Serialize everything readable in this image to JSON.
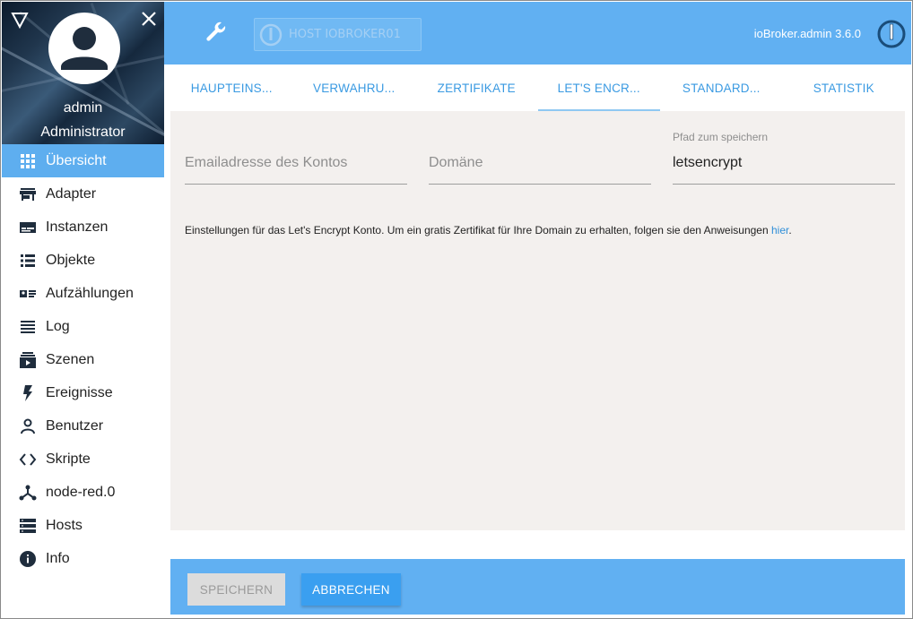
{
  "sidebar": {
    "user": {
      "name": "admin",
      "role": "Administrator"
    },
    "items": [
      {
        "label": "Übersicht",
        "icon": "apps-grid-icon",
        "active": true
      },
      {
        "label": "Adapter",
        "icon": "store-icon"
      },
      {
        "label": "Instanzen",
        "icon": "instances-icon"
      },
      {
        "label": "Objekte",
        "icon": "list-icon"
      },
      {
        "label": "Aufzählungen",
        "icon": "enum-icon"
      },
      {
        "label": "Log",
        "icon": "log-lines-icon"
      },
      {
        "label": "Szenen",
        "icon": "scenes-icon"
      },
      {
        "label": "Ereignisse",
        "icon": "flash-icon"
      },
      {
        "label": "Benutzer",
        "icon": "user-icon"
      },
      {
        "label": "Skripte",
        "icon": "code-icon"
      },
      {
        "label": "node-red.0",
        "icon": "node-red-icon"
      },
      {
        "label": "Hosts",
        "icon": "hosts-icon"
      },
      {
        "label": "Info",
        "icon": "info-icon"
      }
    ]
  },
  "topbar": {
    "host_label": "HOST IOBROKER01",
    "version": "ioBroker.admin 3.6.0"
  },
  "tabs": [
    {
      "label": "HAUPTEINS..."
    },
    {
      "label": "VERWAHRU..."
    },
    {
      "label": "ZERTIFIKATE"
    },
    {
      "label": "LET'S ENCR...",
      "active": true
    },
    {
      "label": "STANDARD..."
    },
    {
      "label": "STATISTIK"
    }
  ],
  "form": {
    "email": {
      "placeholder": "Emailadresse des Kontos",
      "value": ""
    },
    "domain": {
      "placeholder": "Domäne",
      "value": ""
    },
    "path": {
      "label": "Pfad zum speichern",
      "value": "letsencrypt"
    }
  },
  "info": {
    "text": "Einstellungen für das Let's Encrypt Konto. Um ein gratis Zertifikat für Ihre Domain zu erhalten, folgen sie den Anweisungen ",
    "link": "hier",
    "suffix": "."
  },
  "footer": {
    "save_label": "SPEICHERN",
    "cancel_label": "ABBRECHEN"
  },
  "colors": {
    "accent": "#61b0f2",
    "active_nav": "#5eaeef",
    "tab_text": "#3a9ae2",
    "content_bg": "#f3f0ee"
  }
}
